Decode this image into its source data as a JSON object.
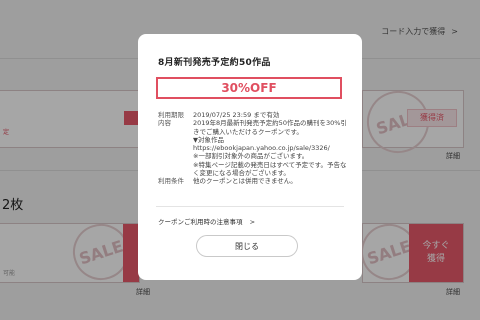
{
  "background": {
    "top_link": "コード入力で獲得",
    "section_count_fragment": "2枚",
    "stamp_text": "SALE",
    "coupon_top_fragment": "定",
    "coupon_bottom_fragment": "可能",
    "acquire_button": "獲得済",
    "acquire_now_line1": "今すぐ",
    "acquire_now_line2": "獲得",
    "detail_link": "詳細",
    "chevron": ">"
  },
  "modal": {
    "title": "8月新刊発売予定約50作品",
    "discount": "30%OFF",
    "rows": [
      {
        "label": "利用期限",
        "lines": [
          "2019/07/25 23:59 まで有効"
        ]
      },
      {
        "label": "内容",
        "lines": [
          "2019年8月最新刊発売予定約50作品の購刊を30%引きでご購入いただけるクーポンです。",
          "▼対象作品",
          "https://ebookjapan.yahoo.co.jp/sale/3326/",
          "※一部割引対象外の商品がございます。",
          "※特集ページ記載の発売日はすべて予定です。予告なく変更になる場合がございます。"
        ]
      },
      {
        "label": "利用条件",
        "lines": [
          "他のクーポンとは併用できません。"
        ]
      }
    ],
    "notes_link": "クーポンご利用時の注意事項",
    "notes_chevron": ">",
    "close_label": "閉じる"
  },
  "colors": {
    "accent": "#e04f60",
    "overlay": "rgba(0,0,0,0.35)"
  }
}
